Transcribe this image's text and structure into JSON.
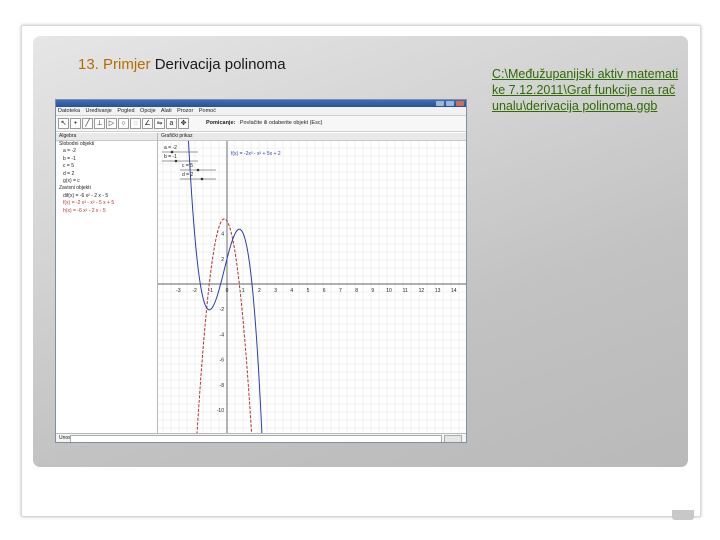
{
  "slide": {
    "title_number": "13. Primjer",
    "title_text": "Derivacija polinoma",
    "file_link": "C:\\Međužupanijski aktiv matematike 7.12.2011\\Graf funkcije na računalu\\derivacija polinoma.ggb"
  },
  "colors": {
    "accent": "#b36e00",
    "link": "#2e6b00",
    "curve_f": "#2a3fb0",
    "curve_deriv": "#b33333"
  },
  "app": {
    "menu": [
      "Datoteka",
      "Uređivanje",
      "Pogled",
      "Opcije",
      "Alati",
      "Prozor",
      "Pomoć"
    ],
    "tools": [
      "pointer-icon",
      "point-icon",
      "line-icon",
      "perpendicular-icon",
      "polygon-icon",
      "circle-icon",
      "ellipse-icon",
      "angle-icon",
      "reflect-icon",
      "slider-icon",
      "move-view-icon"
    ],
    "formula_bar_label": "Pomicanje:",
    "formula_bar_hint": "Povlačite ili odaberite objekt (Esc)",
    "algebra_title": "Algebra",
    "algebra_free": "Slobodni objekti",
    "algebra_items": [
      "a = -2",
      "b = -1",
      "c = 5",
      "d = 2",
      "g(x) = c"
    ],
    "algebra_dependent": "Zavisni objekti",
    "algebra_dep_items": [
      "dif(x) = -6 x² - 2 x - 5",
      "f(x) = -2 x³ - x² - 5 x + 5",
      "h(x) = -6 x² - 2 x - 5"
    ],
    "graphics_title": "Grafički prikaz",
    "sliders": [
      "a = -2",
      "b = -1",
      "c = 5",
      "d = 2"
    ],
    "function_label": "f(x) = -2x³ - x² + 5x + 2",
    "x_ticks": [
      "-3",
      "-2",
      "-1",
      "0",
      "1",
      "2",
      "3",
      "4",
      "5",
      "6",
      "7",
      "8",
      "9",
      "10",
      "11",
      "12",
      "13",
      "14",
      "15",
      "16"
    ],
    "y_ticks": [
      "4",
      "2",
      "-2",
      "-4",
      "-6",
      "-8",
      "-10",
      "-12"
    ],
    "input_label": "Unos:"
  }
}
